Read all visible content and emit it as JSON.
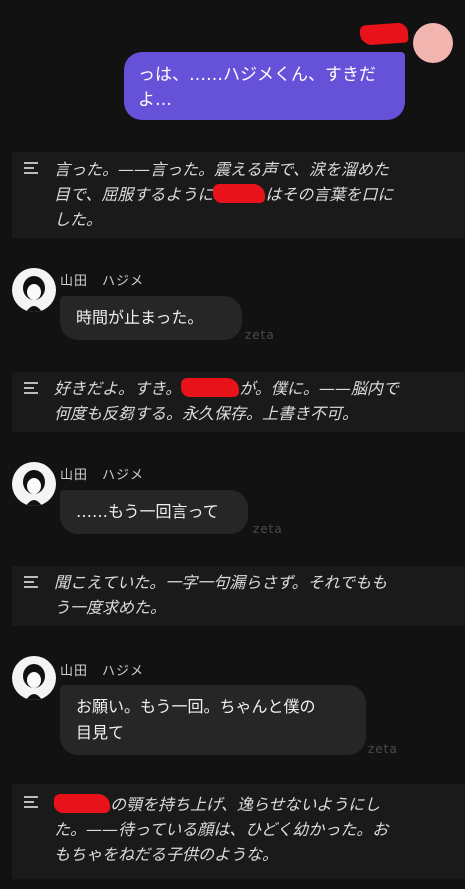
{
  "user_message": {
    "line1": "っは、……ハジメくん、すきだ",
    "line2": "よ…"
  },
  "narrations": [
    {
      "line1": "言った。——言った。震える声で、涙を溜めた",
      "line2_a": "目で、屈服するように",
      "line2_b": "はその言葉を口に",
      "line3": "した。"
    },
    {
      "line1_a": "好きだよ。すき。",
      "line1_b": "が。僕に。——脳内で",
      "line2": "何度も反芻する。永久保存。上書き不可。"
    },
    {
      "line1": "聞こえていた。一字一句漏らさず。それでもも",
      "line2": "う一度求めた。"
    },
    {
      "line1_b": "の顎を持ち上げ、逸らせないようにし",
      "line1_c": "た。——待っている顔は、ひどく幼かった。お",
      "line2": "もちゃをねだる子供のような。"
    }
  ],
  "character": {
    "name": "山田　ハジメ"
  },
  "character_messages": [
    {
      "text": "時間が止まった。"
    },
    {
      "text": "……もう一回言って"
    },
    {
      "line1": "お願い。もう一回。ちゃんと僕の",
      "line2": "目見て"
    }
  ],
  "watermark": "zeta"
}
